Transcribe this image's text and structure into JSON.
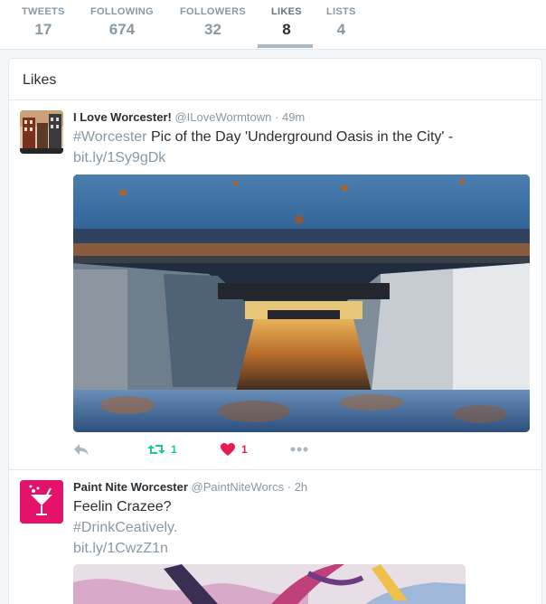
{
  "nav": {
    "items": [
      {
        "label": "TWEETS",
        "value": "17"
      },
      {
        "label": "FOLLOWING",
        "value": "674"
      },
      {
        "label": "FOLLOWERS",
        "value": "32"
      },
      {
        "label": "LIKES",
        "value": "8"
      },
      {
        "label": "LISTS",
        "value": "4"
      }
    ],
    "active": "LIKES"
  },
  "card": {
    "title": "Likes"
  },
  "tweets": [
    {
      "name": "I Love Worcester!",
      "handle": "@ILoveWormtown",
      "dot": "·",
      "time": "49m",
      "hashtag": "#Worcester",
      "text": " Pic of the Day 'Underground Oasis in the City' -",
      "link": "bit.ly/1Sy9gDk",
      "retweets": "1",
      "likes": "1"
    },
    {
      "name": "Paint Nite Worcester",
      "handle": "@PaintNiteWorcs",
      "dot": "·",
      "time": "2h",
      "line1": "Feelin Crazee?",
      "hashtag": "#DrinkCeatively",
      "period": ".",
      "link": "bit.ly/1CwzZ1n"
    }
  ],
  "colors": {
    "retweet_green": "#19cf86",
    "like_red": "#e81c4f",
    "link_grey": "#8899a6",
    "paintnite_pink": "#e4126b"
  }
}
